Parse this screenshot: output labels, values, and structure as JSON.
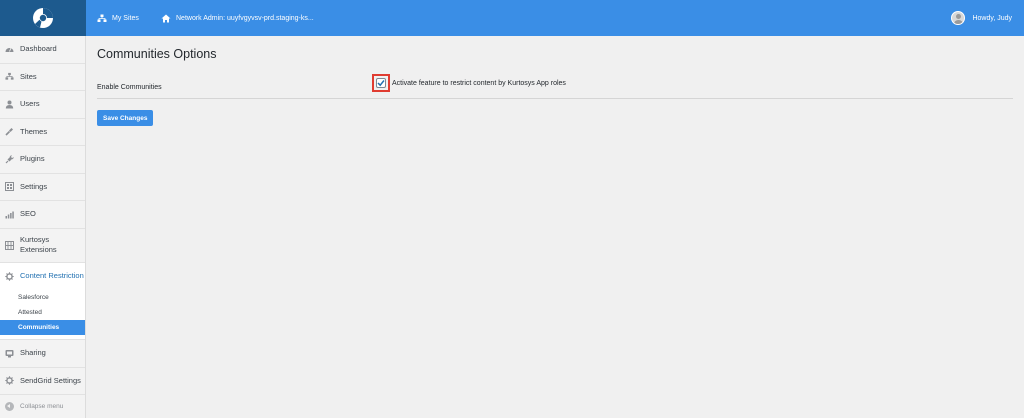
{
  "topbar": {
    "my_sites": "My Sites",
    "network_admin": "Network Admin: uuyfvgyvsv-prd.staging-ks...",
    "howdy": "Howdy, Judy",
    "bg_color": "#3a8ee6",
    "logo_bg_color": "#1d5a8e"
  },
  "sidebar": {
    "items": [
      {
        "label": "Dashboard",
        "icon": "dashboard-icon"
      },
      {
        "label": "Sites",
        "icon": "sites-icon"
      },
      {
        "label": "Users",
        "icon": "users-icon"
      },
      {
        "label": "Themes",
        "icon": "themes-icon"
      },
      {
        "label": "Plugins",
        "icon": "plugins-icon"
      },
      {
        "label": "Settings",
        "icon": "settings-icon"
      },
      {
        "label": "SEO",
        "icon": "seo-icon"
      },
      {
        "label": "Kurtosys Extensions",
        "icon": "kurtosys-icon"
      },
      {
        "label": "Content Restriction",
        "icon": "gear-icon"
      },
      {
        "label": "Sharing",
        "icon": "sharing-icon"
      },
      {
        "label": "SendGrid Settings",
        "icon": "gear-icon"
      }
    ],
    "submenu": [
      "Salesforce",
      "Attested",
      "Communities"
    ],
    "collapse": "Collapse menu",
    "active_color": "#3a8ee6"
  },
  "main": {
    "title": "Communities Options",
    "enable_label": "Enable Communities",
    "checkbox_text": "Activate feature to restrict content by Kurtosys App roles",
    "checkbox_checked": true,
    "save_label": "Save Changes",
    "highlight_color": "#e03c31"
  }
}
